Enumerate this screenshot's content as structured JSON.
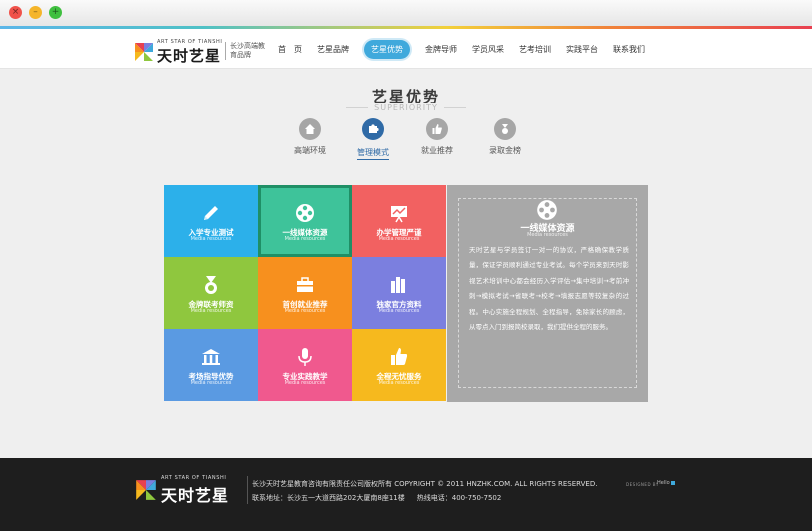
{
  "window": {
    "controls": {
      "close": "×",
      "minimize": "–",
      "maximize": "+"
    }
  },
  "brand": {
    "name_en": "ART STAR OF TIANSHI",
    "name_cn": "天时艺星",
    "slogan": "长沙高端教育品牌"
  },
  "nav": [
    {
      "label": "首　页"
    },
    {
      "label": "艺星品牌"
    },
    {
      "label": "艺星优势",
      "active": true
    },
    {
      "label": "金牌导师"
    },
    {
      "label": "学员风采"
    },
    {
      "label": "艺考培训"
    },
    {
      "label": "实践平台"
    },
    {
      "label": "联系我们"
    }
  ],
  "section": {
    "title": "艺星优势",
    "subtitle": "SUPERIORITY"
  },
  "tabs": [
    {
      "label": "高端环境",
      "icon": "home-icon"
    },
    {
      "label": "管理模式",
      "icon": "puzzle-icon",
      "active": true
    },
    {
      "label": "就业推荐",
      "icon": "thumbs-up-icon"
    },
    {
      "label": "录取金榜",
      "icon": "medal-icon"
    }
  ],
  "tiles": [
    {
      "title": "入学专业测试",
      "sub": "Media resources",
      "color": "#2cb0ea",
      "icon": "pencil-icon"
    },
    {
      "title": "一线媒体资源",
      "sub": "Media resources",
      "color": "#3ec39a",
      "icon": "film-reel-icon",
      "selected": true
    },
    {
      "title": "办学管理严谨",
      "sub": "Media resources",
      "color": "#f26161",
      "icon": "chart-board-icon"
    },
    {
      "title": "金牌联考师资",
      "sub": "Media resources",
      "color": "#8fc73e",
      "icon": "medal-icon"
    },
    {
      "title": "首创就业推荐",
      "sub": "Media resources",
      "color": "#f7901e",
      "icon": "briefcase-icon"
    },
    {
      "title": "独家官方资料",
      "sub": "Media resources",
      "color": "#7b7fdf",
      "icon": "books-icon"
    },
    {
      "title": "考场指导优势",
      "sub": "Media resources",
      "color": "#5a9ae2",
      "icon": "building-icon"
    },
    {
      "title": "专业实践教学",
      "sub": "Media resources",
      "color": "#f0598e",
      "icon": "microphone-icon"
    },
    {
      "title": "全程无忧服务",
      "sub": "Media resources",
      "color": "#f6b91e",
      "icon": "thumbs-up-icon"
    }
  ],
  "detail": {
    "title": "一线媒体资源",
    "subtitle": "Media resources",
    "icon": "film-reel-icon",
    "text": "天时艺星与学员签订一对一的协议，严格确保教学质量，保证学员顺利通过专业考试。每个学员来到天时影视艺术培训中心都会经历入学评估→集中培训→考前冲刺→模拟考试→省联考→校考→填报志愿等较复杂的过程。中心实施全程规划、全程指导，免除家长的顾虑，从零点入门到报简校录取，我们提供全程的服务。"
  },
  "footer": {
    "copyright": "长沙天时艺星教育咨询有限责任公司版权所有 COPYRIGHT © 2011 HNZHK.COM. ALL RIGHTS RESERVED.",
    "address": "联系地址：长沙五一大道西路202大厦南8座11楼",
    "phone": "热线电话：400-750-7502",
    "designed_by": "DESIGNED BY",
    "designer": "Hello"
  }
}
